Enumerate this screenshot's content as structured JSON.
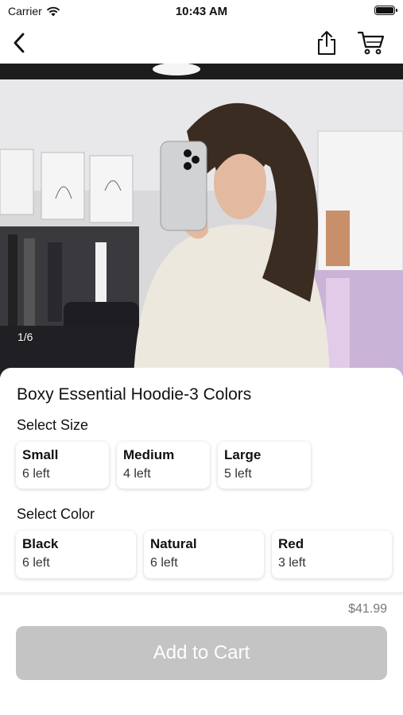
{
  "status": {
    "carrier": "Carrier",
    "time": "10:43 AM"
  },
  "gallery": {
    "indicator": "1/6"
  },
  "product": {
    "title": "Boxy Essential Hoodie-3 Colors",
    "size_label": "Select Size",
    "sizes": [
      {
        "name": "Small",
        "stock": "6 left"
      },
      {
        "name": "Medium",
        "stock": "4 left"
      },
      {
        "name": "Large",
        "stock": "5 left"
      }
    ],
    "color_label": "Select Color",
    "colors": [
      {
        "name": "Black",
        "stock": "6 left"
      },
      {
        "name": "Natural",
        "stock": "6 left"
      },
      {
        "name": "Red",
        "stock": "3 left"
      }
    ]
  },
  "footer": {
    "price": "$41.99",
    "add_to_cart": "Add to Cart"
  }
}
